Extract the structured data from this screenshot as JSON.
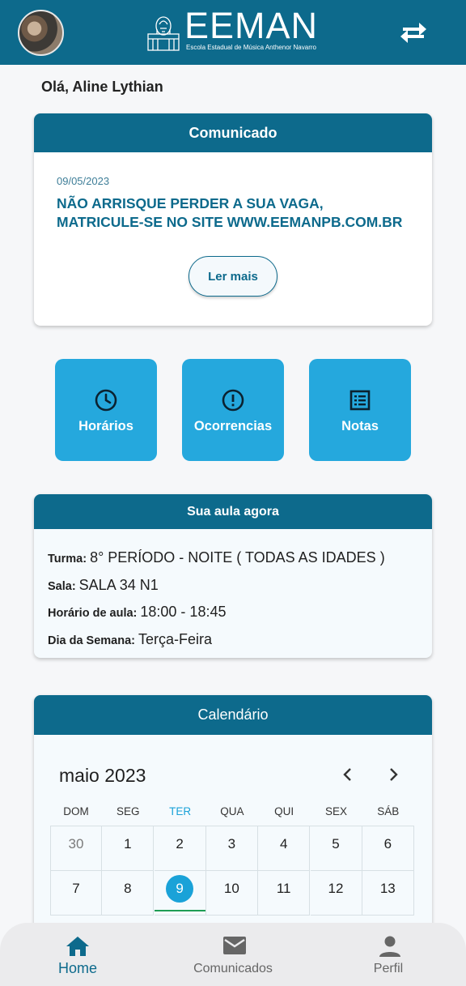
{
  "header": {
    "logo_title": "EEMAN",
    "logo_subtitle": "Escola Estadual de Música Anthenor Navarro",
    "swap_icon": "swap-arrows-icon",
    "color": "#0d6a8c"
  },
  "greeting": "Olá, Aline Lythian",
  "notice": {
    "title": "Comunicado",
    "date": "09/05/2023",
    "text": "NÃO ARRISQUE PERDER A SUA VAGA, MATRICULE-SE NO SITE WWW.EEMANPB.COM.BR",
    "button": "Ler mais"
  },
  "shortcuts": [
    {
      "label": "Horários",
      "icon": "clock-icon"
    },
    {
      "label": "Ocorrencias",
      "icon": "alert-circle-icon"
    },
    {
      "label": "Notas",
      "icon": "list-icon"
    }
  ],
  "current_class": {
    "title": "Sua aula agora",
    "rows": [
      {
        "key": "Turma:",
        "value": "8° PERÍODO - NOITE ( TODAS AS IDADES )"
      },
      {
        "key": "Sala:",
        "value": "SALA 34 N1"
      },
      {
        "key": "Horário de aula:",
        "value": "18:00 - 18:45"
      },
      {
        "key": "Dia da Semana:",
        "value": "Terça-Feira"
      }
    ]
  },
  "calendar": {
    "title": "Calendário",
    "month": "maio 2023",
    "weekdays": [
      "DOM",
      "SEG",
      "TER",
      "QUA",
      "QUI",
      "SEX",
      "SÁB"
    ],
    "today_weekday_index": 2,
    "weeks": [
      [
        "30",
        "1",
        "2",
        "3",
        "4",
        "5",
        "6"
      ],
      [
        "7",
        "8",
        "9",
        "10",
        "11",
        "12",
        "13"
      ]
    ],
    "today": "9",
    "accent_color": "#1aa2d8"
  },
  "bottom_nav": [
    {
      "label": "Home",
      "icon": "home-icon",
      "active": true
    },
    {
      "label": "Comunicados",
      "icon": "mail-icon",
      "active": false
    },
    {
      "label": "Perfil",
      "icon": "person-icon",
      "active": false
    }
  ]
}
